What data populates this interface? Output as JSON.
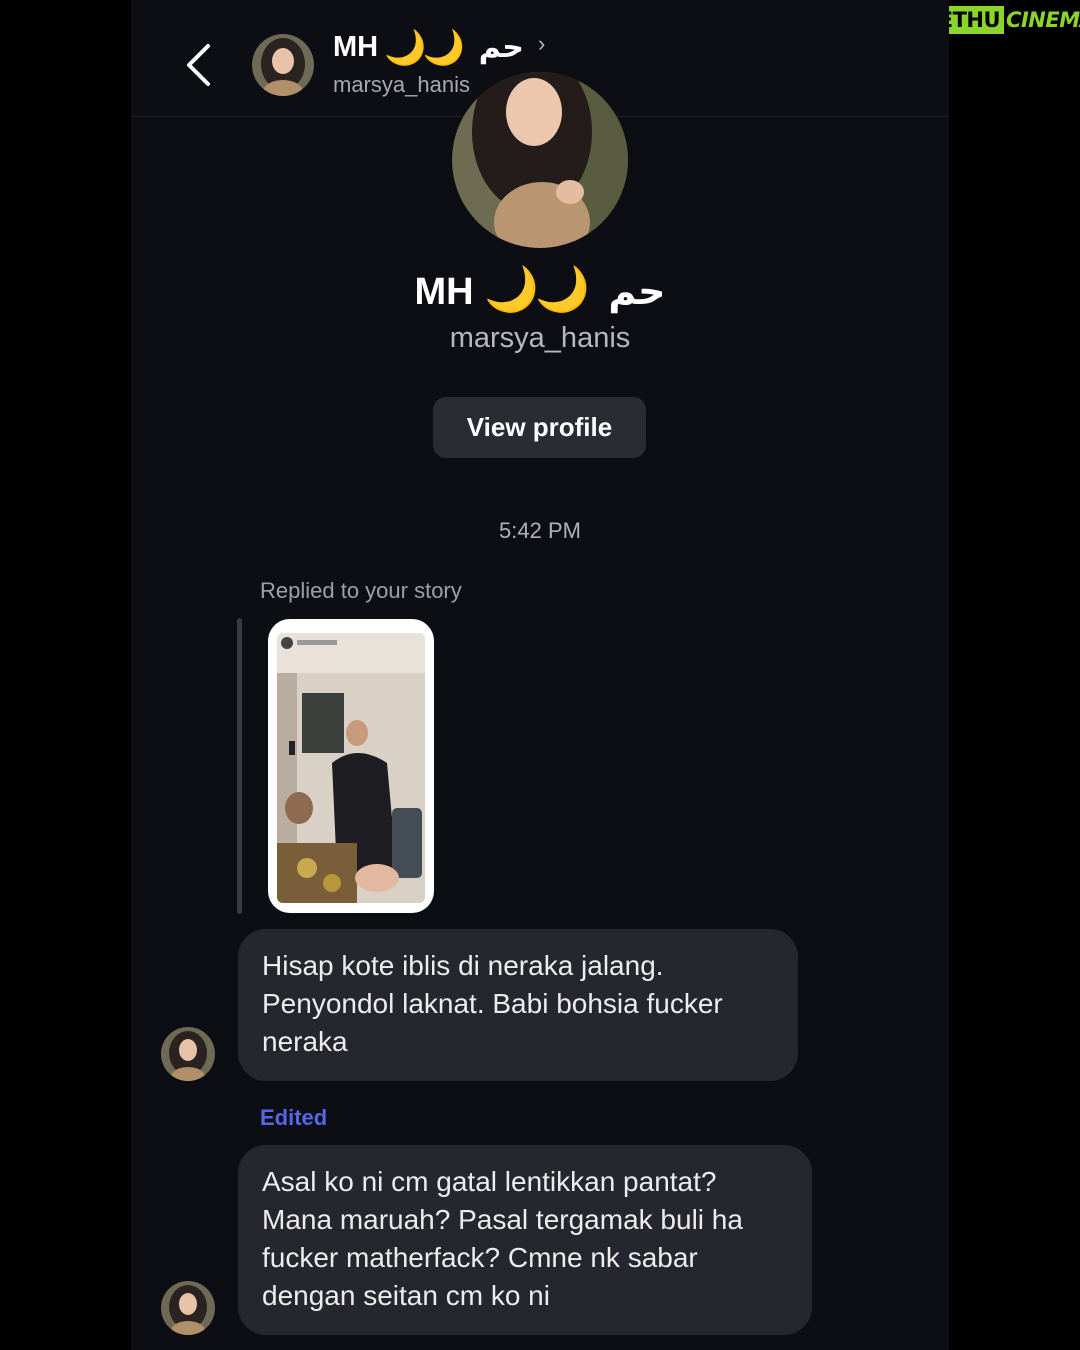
{
  "watermark": {
    "part1": "GETHU",
    "part2": "CINEMA"
  },
  "header": {
    "name": "MH",
    "moons": "🌙🌙",
    "arabic": "حم",
    "chevron": "›",
    "username": "marsya_hanis"
  },
  "profile": {
    "name": "MH",
    "moons": "🌙🌙",
    "arabic": "حم",
    "username": "marsya_hanis",
    "view_profile_label": "View profile"
  },
  "thread": {
    "timestamp": "5:42 PM",
    "reply_label": "Replied to your story",
    "messages": [
      {
        "text": "Hisap kote iblis di neraka jalang. Penyondol laknat. Babi bohsia fucker neraka"
      },
      {
        "edited_label": "Edited",
        "text": "Asal ko ni cm gatal lentikkan pantat? Mana maruah? Pasal tergamak buli ha fucker matherfack? Cmne nk sabar dengan seitan cm ko ni"
      }
    ]
  },
  "icons": {
    "back": "chevron-left-icon",
    "header_chevron": "chevron-right-icon"
  },
  "colors": {
    "background": "#0d0e13",
    "bubble": "#26272e",
    "edited": "#5865e8",
    "moon": "#f5c542",
    "watermark": "#8bd52b"
  }
}
